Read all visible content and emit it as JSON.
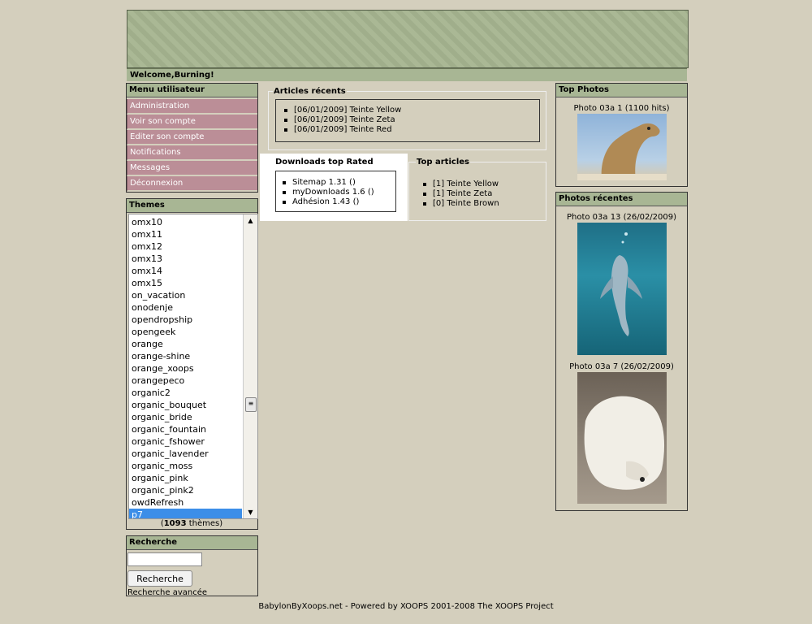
{
  "welcome": "Welcome,Burning!",
  "user_menu": {
    "title": "Menu utilisateur",
    "items": [
      "Administration",
      "Voir son compte",
      "Editer son compte",
      "Notifications",
      "Messages",
      "Déconnexion"
    ]
  },
  "themes": {
    "title": "Themes",
    "options": [
      "omx10",
      "omx11",
      "omx12",
      "omx13",
      "omx14",
      "omx15",
      "on_vacation",
      "onodenje",
      "opendropship",
      "opengeek",
      "orange",
      "orange-shine",
      "orange_xoops",
      "orangepeco",
      "organic2",
      "organic_bouquet",
      "organic_bride",
      "organic_fountain",
      "organic_fshower",
      "organic_lavender",
      "organic_moss",
      "organic_pink",
      "organic_pink2",
      "owdRefresh",
      "p7"
    ],
    "selected": "p7",
    "count": "1093",
    "count_suffix": " thèmes)",
    "count_prefix": "("
  },
  "search": {
    "title": "Recherche",
    "value": "",
    "button": "Recherche",
    "advanced": "Recherche avancée"
  },
  "recent_articles": {
    "title": "Articles récents",
    "items": [
      "[06/01/2009] Teinte Yellow",
      "[06/01/2009] Teinte Zeta",
      "[06/01/2009] Teinte Red"
    ]
  },
  "downloads_top": {
    "title": "Downloads top Rated",
    "items": [
      "Sitemap 1.31 ()",
      "myDownloads 1.6 ()",
      "Adhésion 1.43 ()"
    ]
  },
  "top_articles": {
    "title": "Top articles",
    "items": [
      "[1] Teinte Yellow",
      "[1] Teinte Zeta",
      "[0] Teinte Brown"
    ]
  },
  "top_photos": {
    "title": "Top Photos",
    "items": [
      {
        "caption": "Photo 03a 1 (1100 hits)",
        "icon": "camel-photo"
      }
    ]
  },
  "recent_photos": {
    "title": "Photos récentes",
    "items": [
      {
        "caption": "Photo 03a 13 (26/02/2009)",
        "icon": "dolphin-photo"
      },
      {
        "caption": "Photo 03a 7 (26/02/2009)",
        "icon": "polar-bear-photo"
      }
    ]
  },
  "footer": "BabylonByXoops.net - Powered by XOOPS 2001-2008 The XOOPS Project",
  "colors": {
    "header": "#a5b48f",
    "menu_item": "#bb8e97",
    "background": "#d4cfbd",
    "selected": "#3c8ee8"
  }
}
